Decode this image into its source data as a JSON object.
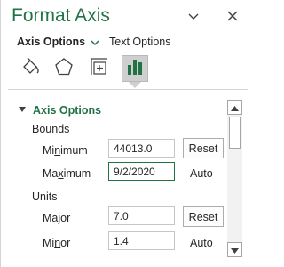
{
  "pane": {
    "title": "Format Axis"
  },
  "header": {
    "dropdown_icon": "chevron-down-icon",
    "close_icon": "close-icon"
  },
  "subtabs": {
    "active_label": "Axis Options",
    "inactive_label": "Text Options"
  },
  "icon_tabs": [
    {
      "name": "fill-line-icon",
      "active": false
    },
    {
      "name": "effects-icon",
      "active": false
    },
    {
      "name": "size-properties-icon",
      "active": false
    },
    {
      "name": "axis-options-icon",
      "active": true
    }
  ],
  "section": {
    "title": "Axis Options",
    "expanded": true
  },
  "bounds": {
    "group_label": "Bounds",
    "minimum": {
      "label_pre": "Mi",
      "label_key": "n",
      "label_post": "imum",
      "value": "44013.0",
      "button": "Reset"
    },
    "maximum": {
      "label_pre": "Ma",
      "label_key": "x",
      "label_post": "imum",
      "value": "9/2/2020",
      "status": "Auto"
    }
  },
  "units": {
    "group_label": "Units",
    "major": {
      "label_pre": "Ma",
      "label_key": "j",
      "label_post": "or",
      "value": "7.0",
      "button": "Reset"
    },
    "minor": {
      "label_pre": "Mi",
      "label_key": "n",
      "label_post": "or",
      "value": "1.4",
      "status": "Auto"
    }
  },
  "colors": {
    "accent": "#217346",
    "text": "#262626",
    "tab_active_bg": "#cfcfcf"
  }
}
